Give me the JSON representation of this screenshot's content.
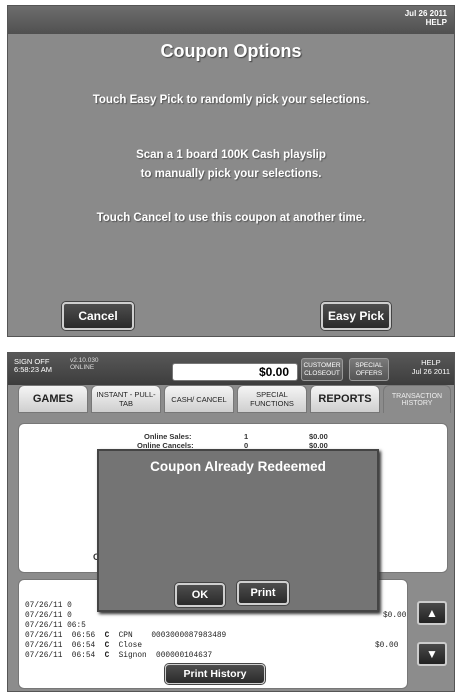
{
  "top_screen": {
    "date": "Jul 26 2011",
    "help": "HELP",
    "title": "Coupon Options",
    "line1": "Touch Easy Pick to randomly pick your selections.",
    "line2": "Scan a 1 board 100K Cash playslip",
    "line3": "to manually pick your selections.",
    "line4": "Touch Cancel to use this coupon at another time.",
    "cancel_label": "Cancel",
    "easy_pick_label": "Easy Pick"
  },
  "bottom_screen": {
    "header": {
      "sign_off": "SIGN OFF",
      "time": "6:58:23 AM",
      "version": "v2.10.030",
      "status": "ONLINE",
      "balance": "$0.00",
      "customer_closeout": "CUSTOMER CLOSEOUT",
      "special_offers": "SPECIAL OFFERS",
      "help": "HELP",
      "date": "Jul 26 2011"
    },
    "tabs": [
      "GAMES",
      "INSTANT - PULL-TAB",
      "CASH/ CANCEL",
      "SPECIAL FUNCTIONS",
      "REPORTS",
      "TRANSACTION HISTORY"
    ],
    "summary": {
      "online_sales_label": "Online Sales:",
      "online_sales_count": "1",
      "online_sales_amount": "$0.00",
      "online_cancels_label": "Online Cancels:",
      "online_cancels_count": "0",
      "online_cancels_amount": "$0.00",
      "partial_char": "C"
    },
    "log": [
      {
        "date": "07/26/11",
        "time": "0",
        "type": "",
        "desc": "",
        "id": "",
        "amount": ""
      },
      {
        "date": "07/26/11",
        "time": "0",
        "type": "",
        "desc": "",
        "id": "",
        "amount": "$0.00"
      },
      {
        "date": "07/26/11",
        "time": "06:5",
        "type": "C",
        "desc": "CPN",
        "id": "0003000087983489",
        "amount": ""
      },
      {
        "date": "07/26/11",
        "time": "06:56",
        "type": "C",
        "desc": "CPN",
        "id": "0003000087983489",
        "amount": ""
      },
      {
        "date": "07/26/11",
        "time": "06:54",
        "type": "C",
        "desc": "Close",
        "id": "",
        "amount": "$0.00"
      },
      {
        "date": "07/26/11",
        "time": "06:54",
        "type": "C",
        "desc": "Signon",
        "id": "000000104637",
        "amount": ""
      }
    ],
    "print_history_label": "Print History",
    "modal": {
      "title": "Coupon Already Redeemed",
      "ok_label": "OK",
      "print_label": "Print"
    }
  }
}
